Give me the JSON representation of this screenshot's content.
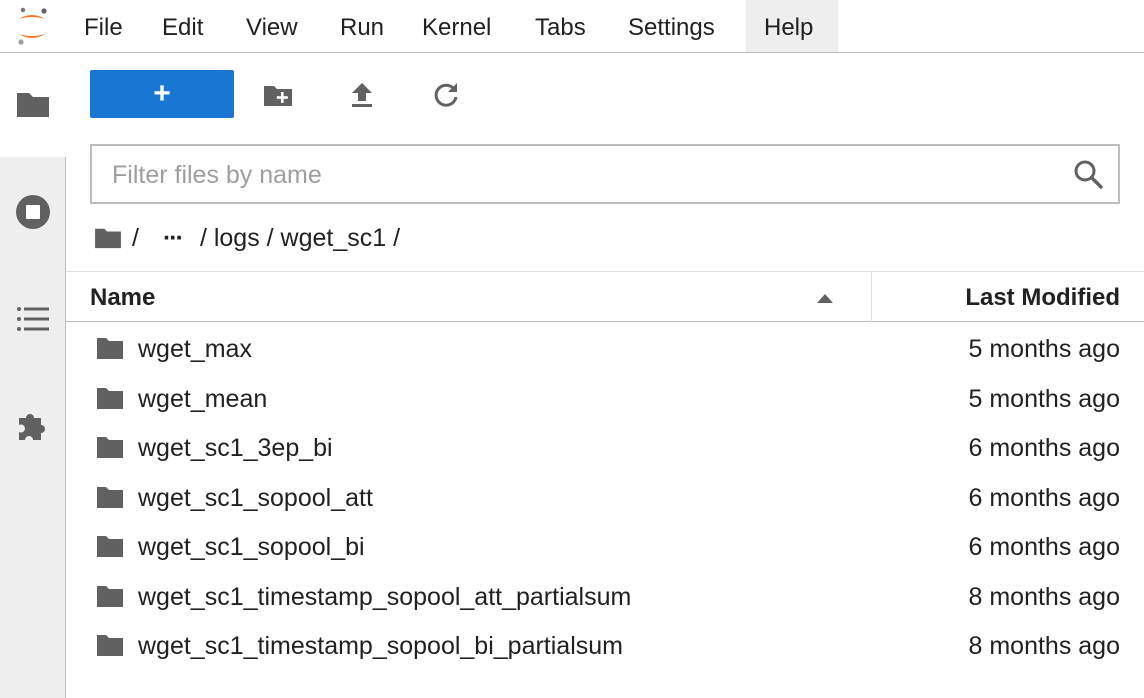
{
  "menu": {
    "items": [
      "File",
      "Edit",
      "View",
      "Run",
      "Kernel",
      "Tabs",
      "Settings",
      "Help"
    ],
    "active": "Help"
  },
  "colors": {
    "accent": "#1976d2",
    "logo": "#f37726",
    "icon": "#616161",
    "sidebar_bg": "#eeeeee"
  },
  "toolbar": {
    "new_launcher_label": "+",
    "icons": [
      "new-folder-icon",
      "upload-icon",
      "refresh-icon"
    ]
  },
  "filter": {
    "placeholder": "Filter files by name",
    "value": ""
  },
  "breadcrumbs": {
    "root_sep": "/",
    "ellipsis": "···",
    "path": "/ logs / wget_sc1 /"
  },
  "list": {
    "header_name": "Name",
    "header_modified": "Last Modified",
    "sort": "ascending",
    "items": [
      {
        "name": "wget_max",
        "modified": "5 months ago"
      },
      {
        "name": "wget_mean",
        "modified": "5 months ago"
      },
      {
        "name": "wget_sc1_3ep_bi",
        "modified": "6 months ago"
      },
      {
        "name": "wget_sc1_sopool_att",
        "modified": "6 months ago"
      },
      {
        "name": "wget_sc1_sopool_bi",
        "modified": "6 months ago"
      },
      {
        "name": "wget_sc1_timestamp_sopool_att_partialsum",
        "modified": "8 months ago"
      },
      {
        "name": "wget_sc1_timestamp_sopool_bi_partialsum",
        "modified": "8 months ago"
      }
    ]
  },
  "sidebar": {
    "icons": [
      "folder-icon",
      "running-stop-icon",
      "table-of-contents-icon",
      "extension-puzzle-icon"
    ],
    "active": "folder-icon"
  }
}
